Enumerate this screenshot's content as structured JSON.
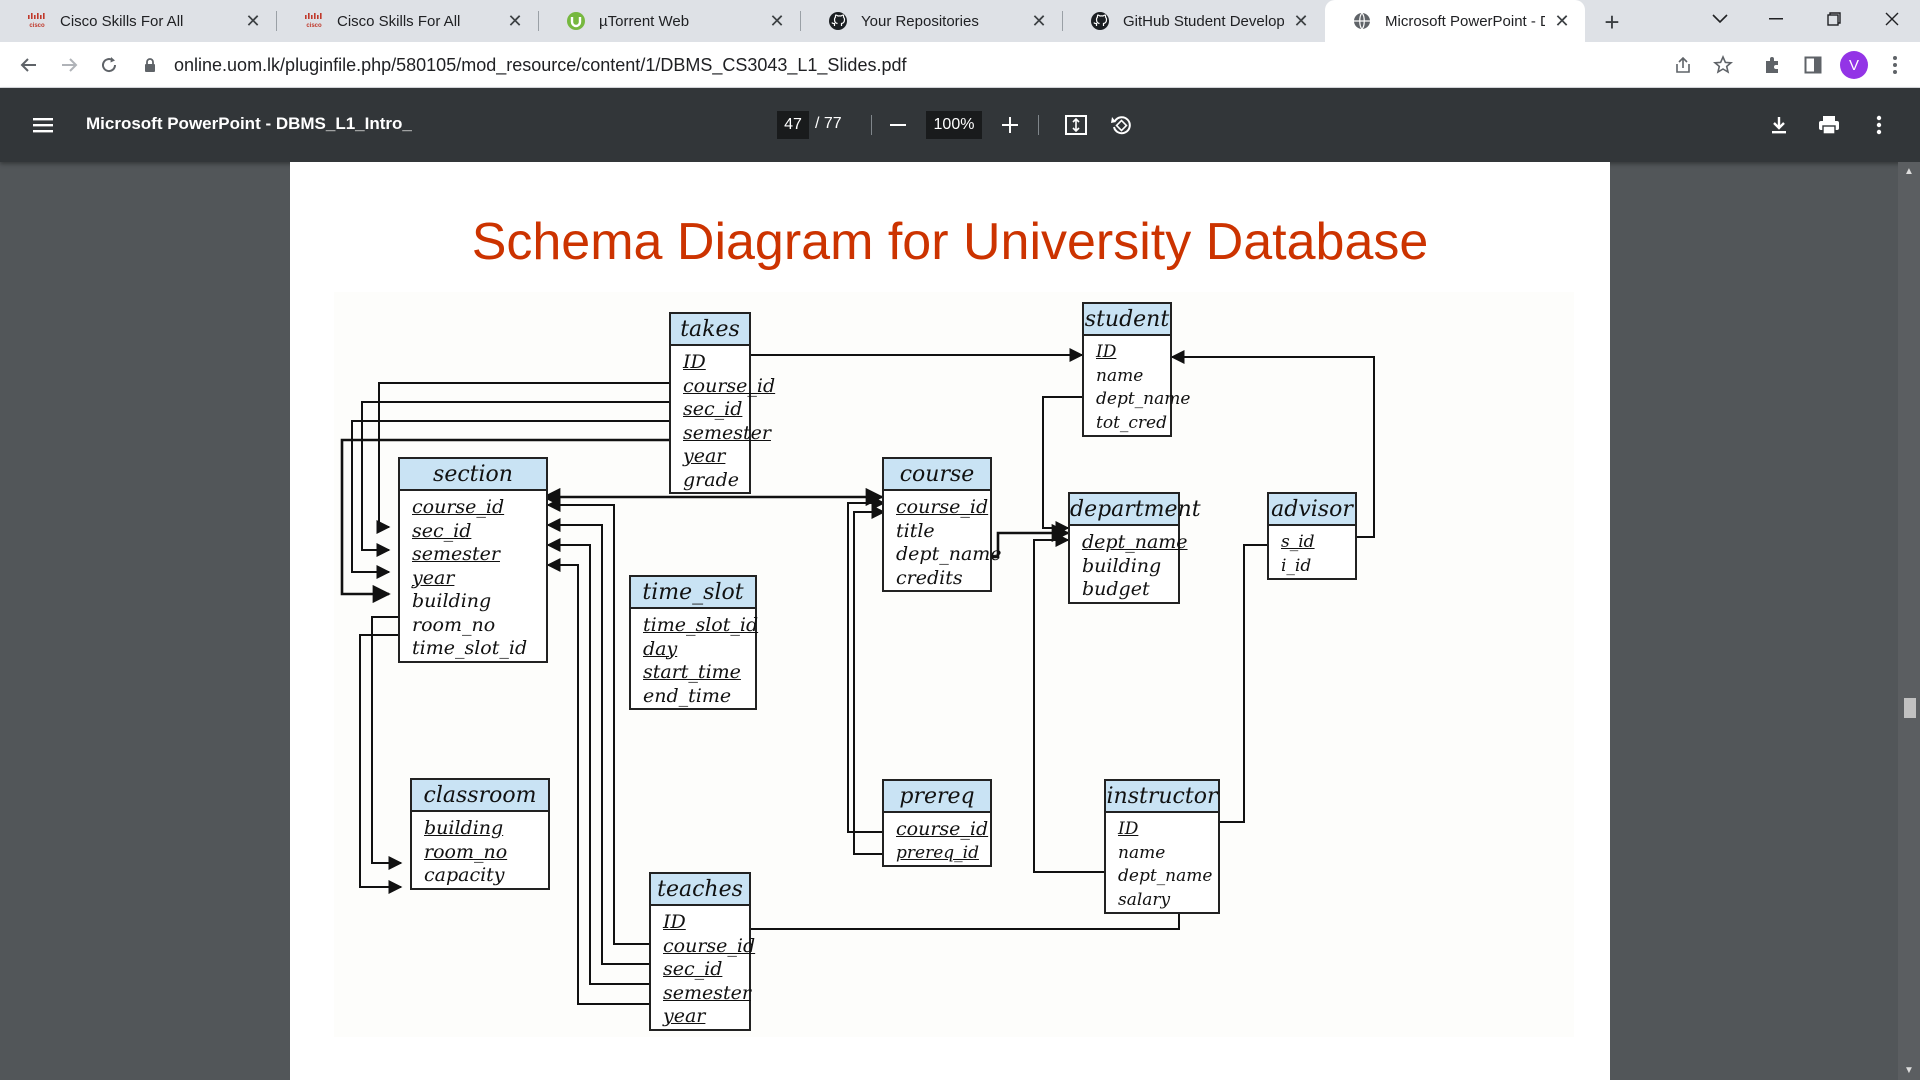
{
  "browser": {
    "tabs": [
      {
        "title": "Cisco Skills For All",
        "icon": "cisco-icon",
        "active": false
      },
      {
        "title": "Cisco Skills For All",
        "icon": "cisco-icon",
        "active": false
      },
      {
        "title": "µTorrent Web",
        "icon": "utorrent-icon",
        "active": false
      },
      {
        "title": "Your Repositories",
        "icon": "github-icon",
        "active": false
      },
      {
        "title": "GitHub Student Developer P",
        "icon": "github-icon",
        "active": false
      },
      {
        "title": "Microsoft PowerPoint - DBM",
        "icon": "globe-icon",
        "active": true
      }
    ],
    "url": "online.uom.lk/pluginfile.php/580105/mod_resource/content/1/DBMS_CS3043_L1_Slides.pdf",
    "profile_initial": "V",
    "profile_color": "#9334e6"
  },
  "pdf_viewer": {
    "title": "Microsoft PowerPoint - DBMS_L1_Intro_",
    "current_page": "47",
    "total_pages": "/ 77",
    "zoom": "100%"
  },
  "slide": {
    "title": "Schema Diagram for University Database",
    "title_color": "#cc3300",
    "header_color": "#c9e3f4",
    "tables": {
      "takes": {
        "name": "takes",
        "attrs": [
          "ID",
          "course_id",
          "sec_id",
          "semester",
          "year",
          "grade"
        ]
      },
      "student": {
        "name": "student",
        "attrs": [
          "ID",
          "name",
          "dept_name",
          "tot_cred"
        ]
      },
      "section": {
        "name": "section",
        "attrs": [
          "course_id",
          "sec_id",
          "semester",
          "year",
          "building",
          "room_no",
          "time_slot_id"
        ]
      },
      "course": {
        "name": "course",
        "attrs": [
          "course_id",
          "title",
          "dept_name",
          "credits"
        ]
      },
      "department": {
        "name": "department",
        "attrs": [
          "dept_name",
          "building",
          "budget"
        ]
      },
      "advisor": {
        "name": "advisor",
        "attrs": [
          "s_id",
          "i_id"
        ]
      },
      "time_slot": {
        "name": "time_slot",
        "attrs": [
          "time_slot_id",
          "day",
          "start_time",
          "end_time"
        ]
      },
      "classroom": {
        "name": "classroom",
        "attrs": [
          "building",
          "room_no",
          "capacity"
        ]
      },
      "prereq": {
        "name": "prereq",
        "attrs": [
          "course_id",
          "prereq_id"
        ]
      },
      "instructor": {
        "name": "instructor",
        "attrs": [
          "ID",
          "name",
          "dept_name",
          "salary"
        ]
      },
      "teaches": {
        "name": "teaches",
        "attrs": [
          "ID",
          "course_id",
          "sec_id",
          "semester",
          "year"
        ]
      }
    }
  }
}
